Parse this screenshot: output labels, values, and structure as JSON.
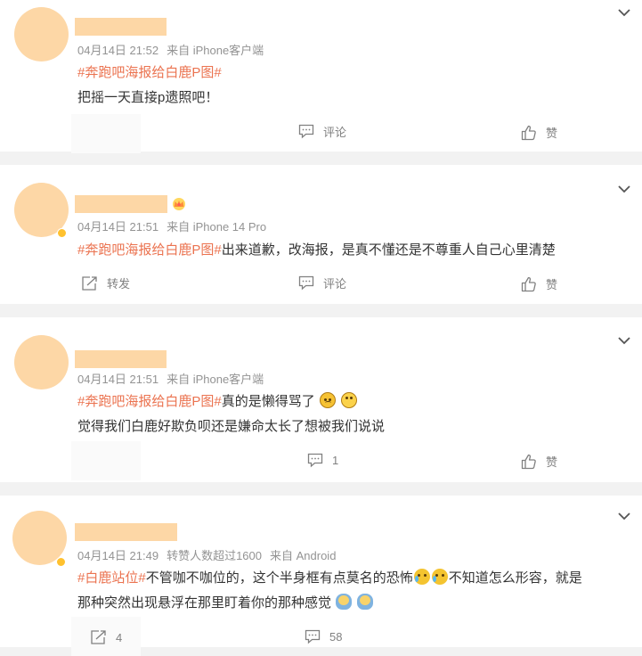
{
  "comments": [
    {
      "time": "04月14日 21:52",
      "source": "来自 iPhone客户端",
      "line1_topic": "#奔跑吧海报给白鹿P图#",
      "line1_text": "",
      "line2": "把摇一天直接p遗照吧！",
      "actions": {
        "comment": "评论",
        "like": "赞"
      }
    },
    {
      "time": "04月14日 21:51",
      "source": "来自 iPhone 14 Pro",
      "line1_topic": "#奔跑吧海报给白鹿P图#",
      "line1_text": "出来道歉，改海报，是真不懂还是不尊重人自己心里清楚",
      "actions": {
        "repost": "转发",
        "comment": "评论",
        "like": "赞"
      }
    },
    {
      "time": "04月14日 21:51",
      "source": "来自 iPhone客户端",
      "line1_topic": "#奔跑吧海报给白鹿P图#",
      "line1_text": "真的是懒得骂了",
      "line2": "觉得我们白鹿好欺负呗还是嫌命太长了想被我们说说",
      "actions": {
        "comment_count": "1",
        "like": "赞"
      }
    },
    {
      "time": "04月14日 21:49",
      "reposts": "转赞人数超过1600",
      "source": "来自 Android",
      "line1_topic": "#白鹿站位#",
      "line1_text_a": "不管咖不咖位的，这个半身框有点莫名的恐怖",
      "line1_text_b": "不知道怎么形容，就是",
      "line2": "那种突然出现悬浮在那里盯着你的那种感觉",
      "actions": {
        "repost_count": "4",
        "comment_count": "58"
      }
    }
  ],
  "icons": [
    "chevron-down-icon",
    "comment-icon",
    "thumbs-up-icon",
    "repost-icon",
    "crown-badge-icon",
    "vip-badge-icon"
  ],
  "colors": {
    "topic": "#eb7350",
    "meta": "#939393",
    "avatar": "#fdd7a6",
    "separator": "#f2f2f2"
  }
}
